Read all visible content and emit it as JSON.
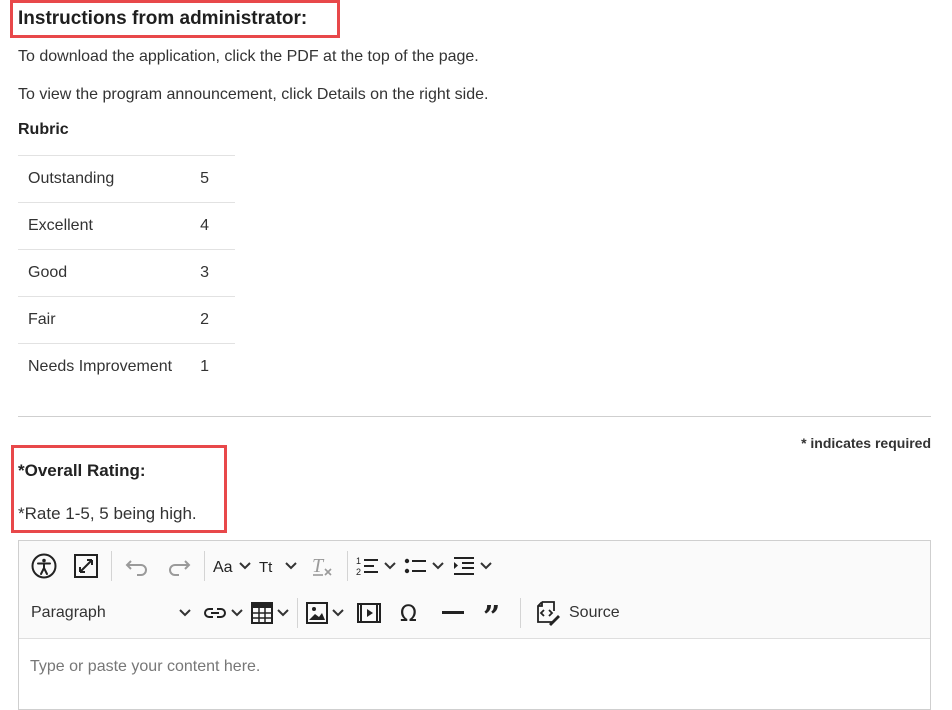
{
  "instructions": {
    "heading": "Instructions from administrator:",
    "line1": "To download the application, click the PDF at the top of the page.",
    "line2": "To view the program announcement, click Details on the right side."
  },
  "rubric": {
    "title": "Rubric",
    "rows": [
      {
        "label": "Outstanding",
        "value": "5"
      },
      {
        "label": "Excellent",
        "value": "4"
      },
      {
        "label": "Good",
        "value": "3"
      },
      {
        "label": "Fair",
        "value": "2"
      },
      {
        "label": "Needs Improvement",
        "value": "1"
      }
    ]
  },
  "form": {
    "required_note": "* indicates required",
    "rating_label": "*Overall Rating:",
    "rating_hint": "*Rate 1-5, 5 being high."
  },
  "editor": {
    "paragraph_select": "Paragraph",
    "source_label": "Source",
    "placeholder": "Type or paste your content here."
  },
  "colors": {
    "highlight": "#e8484a",
    "toolbar_bg": "#fafafa",
    "border": "#cfcfcf"
  }
}
